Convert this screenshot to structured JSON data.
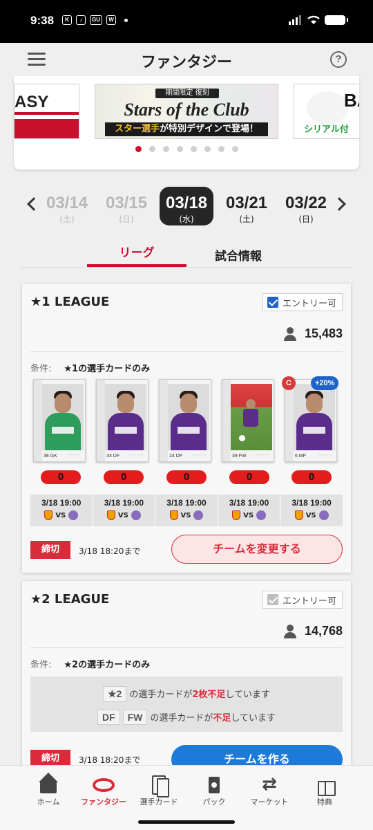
{
  "status_bar": {
    "time": "9:38",
    "apps": [
      "K",
      "♪",
      "GU",
      "W"
    ]
  },
  "header": {
    "title": "ファンタジー"
  },
  "banner": {
    "left_text": "ASY",
    "main": {
      "top": "期間限定 復刻",
      "title": "Stars of the Club",
      "sub_prefix": "スター選手",
      "sub_suffix": "が特別デザインで登場！"
    },
    "right_text": "BA",
    "right_sub": "シリアル付",
    "dots_total": 8,
    "active_dot": 0
  },
  "dates": [
    {
      "date": "03/14",
      "weekday": "(土)",
      "state": "past"
    },
    {
      "date": "03/15",
      "weekday": "(日)",
      "state": "past"
    },
    {
      "date": "03/18",
      "weekday": "(水)",
      "state": "selected"
    },
    {
      "date": "03/21",
      "weekday": "(土)",
      "state": "future"
    },
    {
      "date": "03/22",
      "weekday": "(日)",
      "state": "future"
    }
  ],
  "tabs": {
    "league": "リーグ",
    "match_info": "試合情報"
  },
  "league1": {
    "title": "★1 LEAGUE",
    "entry_label": "エントリー可",
    "participants": "15,483",
    "condition_key": "条件:",
    "condition": "★1の選手カードのみ",
    "cards": [
      {
        "num": "38",
        "pos": "GK"
      },
      {
        "num": "33",
        "pos": "DF"
      },
      {
        "num": "24",
        "pos": "DF"
      },
      {
        "num": "39",
        "pos": "FW"
      },
      {
        "num": "6",
        "pos": "MF"
      }
    ],
    "captain": "C",
    "bonus": "+20%",
    "scores": [
      "0",
      "0",
      "0",
      "0",
      "0"
    ],
    "matches": [
      {
        "time": "3/18 19:00",
        "vs": "VS"
      },
      {
        "time": "3/18 19:00",
        "vs": "VS"
      },
      {
        "time": "3/18 19:00",
        "vs": "VS"
      },
      {
        "time": "3/18 19:00",
        "vs": "VS"
      },
      {
        "time": "3/18 19:00",
        "vs": "VS"
      }
    ],
    "deadline_tag": "締切",
    "deadline": "3/18 18:20まで",
    "button": "チームを変更する"
  },
  "league2": {
    "title": "★2 LEAGUE",
    "entry_label": "エントリー可",
    "participants": "14,768",
    "condition_key": "条件:",
    "condition": "★2の選手カードのみ",
    "warn1": {
      "chip": "★2",
      "pre": "の選手カードが",
      "red": "2枚不足",
      "post": "しています"
    },
    "warn2": {
      "chip1": "DF",
      "chip2": "FW",
      "pre": "の選手カードが",
      "red": "不足",
      "post": "しています"
    },
    "deadline_tag": "締切",
    "deadline": "3/18 18:20まで",
    "button": "チームを作る"
  },
  "nav": [
    {
      "label": "ホーム",
      "icon": "home-icon"
    },
    {
      "label": "ファンタジー",
      "icon": "stadium-icon",
      "active": true
    },
    {
      "label": "選手カード",
      "icon": "cards-icon"
    },
    {
      "label": "パック",
      "icon": "pack-icon"
    },
    {
      "label": "マーケット",
      "icon": "exchange-icon"
    },
    {
      "label": "特典",
      "icon": "gift-icon"
    }
  ],
  "colors": {
    "accent_red": "#d92b3a",
    "blue": "#1e7ad9",
    "score_red": "#e31d1d"
  }
}
